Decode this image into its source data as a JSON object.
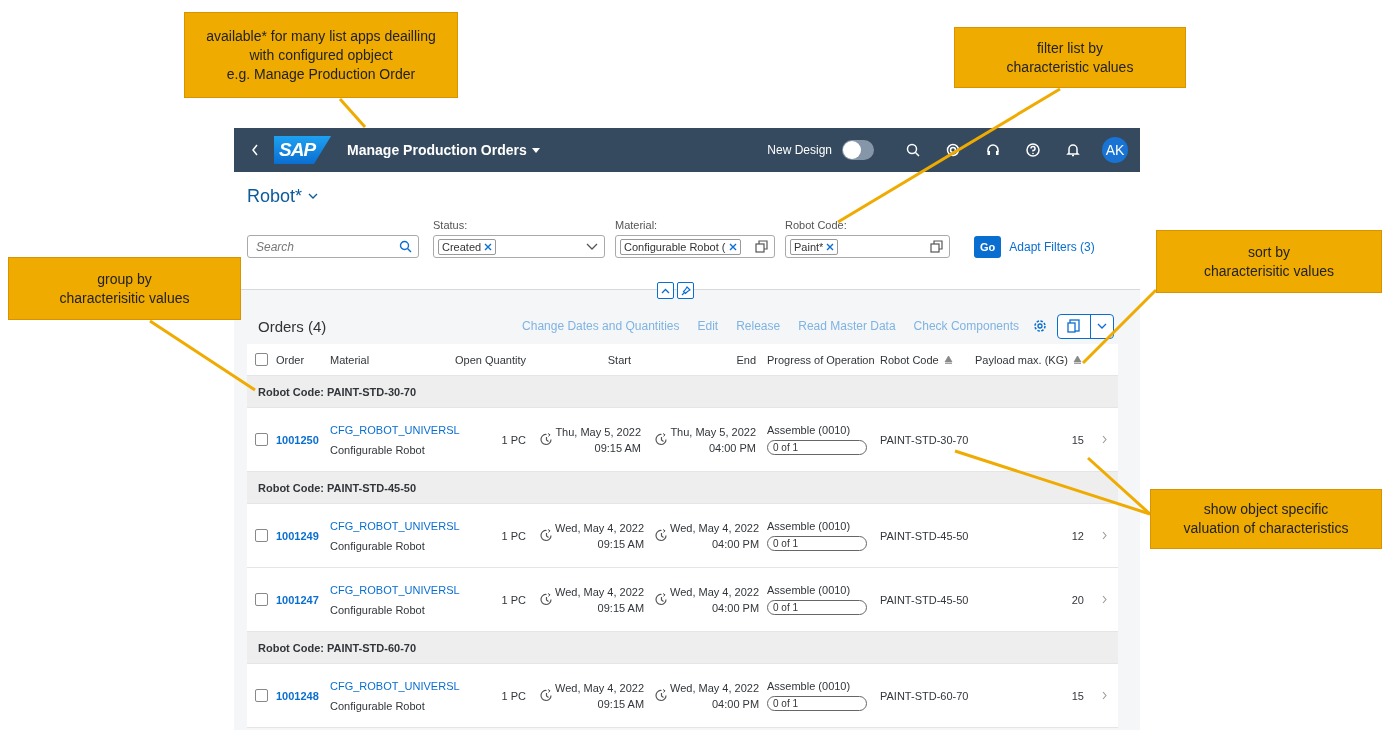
{
  "callouts": [
    {
      "text": "available* for many list apps deailling\nwith configured opbject\ne.g. Manage Production Order"
    },
    {
      "text": "filter list by\ncharacteristic values"
    },
    {
      "text": "group by\ncharacterisitic values"
    },
    {
      "text": "sort by\ncharacterisitic values"
    },
    {
      "text": "show object specific\nvaluation of characteristics"
    }
  ],
  "shell": {
    "logo": "SAP",
    "title": "Manage Production Orders",
    "design_label": "New Design",
    "design_on": false,
    "avatar": "AK"
  },
  "variant": "Robot*",
  "filter_bar": {
    "search": {
      "placeholder": "Search"
    },
    "fields": [
      {
        "label": "Status:",
        "token": "Created",
        "kind": "dropdown"
      },
      {
        "label": "Material:",
        "token": "Configurable Robot (",
        "kind": "valuehelp"
      },
      {
        "label": "Robot Code:",
        "token": "Paint*",
        "kind": "valuehelp"
      }
    ],
    "go": "Go",
    "adapt": "Adapt Filters (3)"
  },
  "table": {
    "title": "Orders (4)",
    "actions": [
      "Change Dates and Quantities",
      "Edit",
      "Release",
      "Read Master Data",
      "Check Components"
    ],
    "select_all": {
      "checked": false
    },
    "columns": [
      {
        "label": "Order",
        "sorted": false
      },
      {
        "label": "Material",
        "sorted": false
      },
      {
        "label": "Open Quantity",
        "sorted": false
      },
      {
        "label": "Start",
        "sorted": false
      },
      {
        "label": "End",
        "sorted": false
      },
      {
        "label": "Progress of Operation",
        "sorted": false
      },
      {
        "label": "Robot Code",
        "sorted": true
      },
      {
        "label": "Payload max. (KG)",
        "sorted": true
      }
    ],
    "rows": [
      {
        "kind": "group",
        "text": "Robot Code: PAINT-STD-30-70"
      },
      {
        "kind": "item",
        "checked": false,
        "order": "1001250",
        "material_id": "CFG_ROBOT_UNIVERSL",
        "material_name": "Configurable Robot",
        "quantity": "1 PC",
        "start_date": "Thu, May 5, 2022",
        "start_time": "09:15 AM",
        "end_date": "Thu, May 5, 2022",
        "end_time": "04:00 PM",
        "operation": "Assemble (0010)",
        "progress": "0 of 1",
        "level": 0,
        "robot_code": "PAINT-STD-30-70",
        "payload": "15"
      },
      {
        "kind": "group",
        "text": "Robot Code: PAINT-STD-45-50"
      },
      {
        "kind": "item",
        "checked": false,
        "order": "1001249",
        "material_id": "CFG_ROBOT_UNIVERSL",
        "material_name": "Configurable Robot",
        "quantity": "1 PC",
        "start_date": "Wed, May 4, 2022",
        "start_time": "09:15 AM",
        "end_date": "Wed, May 4, 2022",
        "end_time": "04:00 PM",
        "operation": "Assemble (0010)",
        "progress": "0 of 1",
        "level": 0,
        "robot_code": "PAINT-STD-45-50",
        "payload": "12"
      },
      {
        "kind": "item",
        "checked": false,
        "order": "1001247",
        "material_id": "CFG_ROBOT_UNIVERSL",
        "material_name": "Configurable Robot",
        "quantity": "1 PC",
        "start_date": "Wed, May 4, 2022",
        "start_time": "09:15 AM",
        "end_date": "Wed, May 4, 2022",
        "end_time": "04:00 PM",
        "operation": "Assemble (0010)",
        "progress": "0 of 1",
        "level": 0,
        "robot_code": "PAINT-STD-45-50",
        "payload": "20"
      },
      {
        "kind": "group",
        "text": "Robot Code: PAINT-STD-60-70"
      },
      {
        "kind": "item",
        "checked": false,
        "order": "1001248",
        "material_id": "CFG_ROBOT_UNIVERSL",
        "material_name": "Configurable Robot",
        "quantity": "1 PC",
        "start_date": "Wed, May 4, 2022",
        "start_time": "09:15 AM",
        "end_date": "Wed, May 4, 2022",
        "end_time": "04:00 PM",
        "operation": "Assemble (0010)",
        "progress": "0 of 1",
        "level": 0,
        "robot_code": "PAINT-STD-60-70",
        "payload": "15"
      }
    ]
  }
}
